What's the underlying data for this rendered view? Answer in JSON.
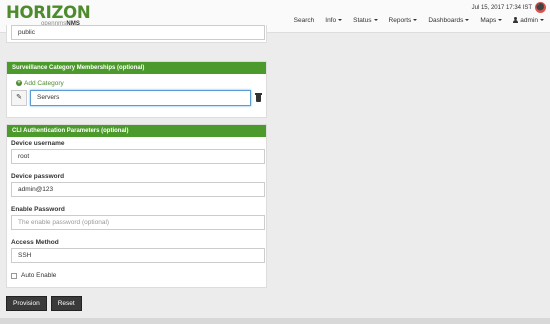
{
  "brand": {
    "main": "HORIZON",
    "sub_prefix": "opennms",
    "sub_suffix": "NMS"
  },
  "header": {
    "clock": "Jul 15, 2017 17:34 IST"
  },
  "nav": {
    "search": "Search",
    "info": "Info",
    "status": "Status",
    "reports": "Reports",
    "dashboards": "Dashboards",
    "maps": "Maps",
    "user": "admin"
  },
  "snmp": {
    "community_value": "public"
  },
  "surveillance": {
    "title": "Surveillance Category Memberships (optional)",
    "add_label": "Add Category",
    "category_value": "Servers"
  },
  "cli": {
    "title": "CLI Authentication Parameters (optional)",
    "username_label": "Device username",
    "username_value": "root",
    "password_label": "Device password",
    "password_value": "admin@123",
    "enable_label": "Enable Password",
    "enable_placeholder": "The enable password (optional)",
    "access_label": "Access Method",
    "access_value": "SSH",
    "auto_enable_label": "Auto Enable"
  },
  "actions": {
    "provision": "Provision",
    "reset": "Reset"
  },
  "colors": {
    "brand_green": "#4d9a2c",
    "alarm_red": "#d9534f",
    "focus_blue": "#5b9bd5"
  }
}
